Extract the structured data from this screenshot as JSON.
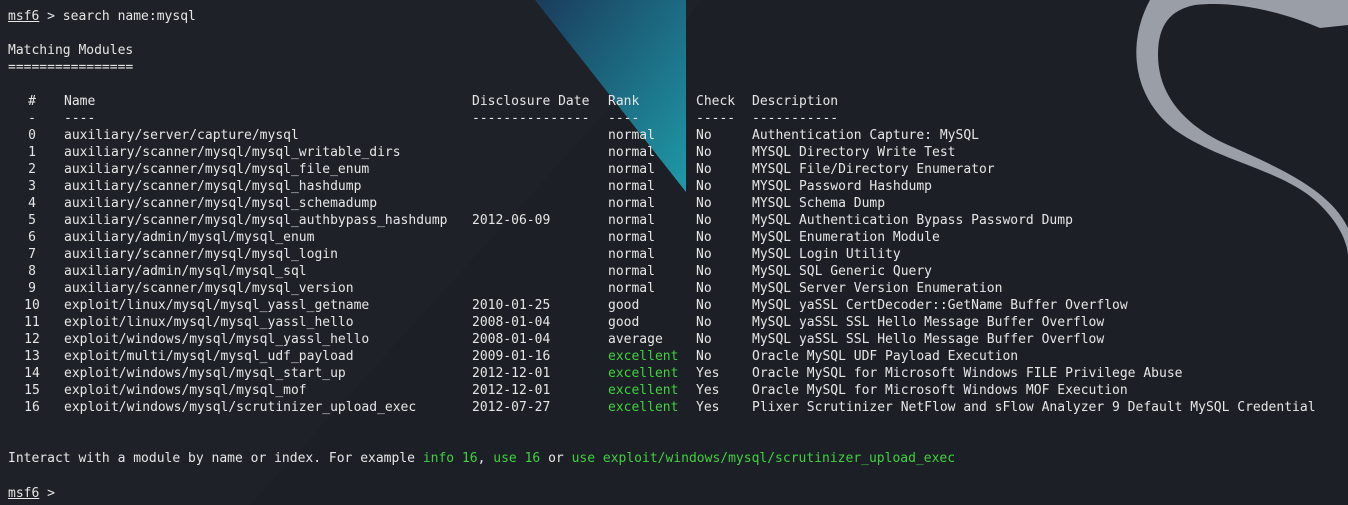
{
  "colors": {
    "background": "#1c1f26",
    "text": "#e6e6e6",
    "highlight": "#3fd13f",
    "accent_teal": "#1e8fa3"
  },
  "prompt": {
    "name": "msf6",
    "arrow": " >",
    "command": " search name:mysql"
  },
  "heading": {
    "title": "Matching Modules",
    "underline": "================"
  },
  "table": {
    "headers": {
      "num": "#",
      "name": "Name",
      "date": "Disclosure Date",
      "rank": "Rank",
      "check": "Check",
      "desc": "Description"
    },
    "dashes": {
      "num": "-",
      "name": "----",
      "date": "---------------",
      "rank": "----",
      "check": "-----",
      "desc": "-----------"
    },
    "rows": [
      {
        "num": "0",
        "name": "auxiliary/server/capture/mysql",
        "date": "",
        "rank": "normal",
        "check": "No",
        "desc": "Authentication Capture: MySQL"
      },
      {
        "num": "1",
        "name": "auxiliary/scanner/mysql/mysql_writable_dirs",
        "date": "",
        "rank": "normal",
        "check": "No",
        "desc": "MYSQL Directory Write Test"
      },
      {
        "num": "2",
        "name": "auxiliary/scanner/mysql/mysql_file_enum",
        "date": "",
        "rank": "normal",
        "check": "No",
        "desc": "MYSQL File/Directory Enumerator"
      },
      {
        "num": "3",
        "name": "auxiliary/scanner/mysql/mysql_hashdump",
        "date": "",
        "rank": "normal",
        "check": "No",
        "desc": "MYSQL Password Hashdump"
      },
      {
        "num": "4",
        "name": "auxiliary/scanner/mysql/mysql_schemadump",
        "date": "",
        "rank": "normal",
        "check": "No",
        "desc": "MYSQL Schema Dump"
      },
      {
        "num": "5",
        "name": "auxiliary/scanner/mysql/mysql_authbypass_hashdump",
        "date": "2012-06-09",
        "rank": "normal",
        "check": "No",
        "desc": "MySQL Authentication Bypass Password Dump"
      },
      {
        "num": "6",
        "name": "auxiliary/admin/mysql/mysql_enum",
        "date": "",
        "rank": "normal",
        "check": "No",
        "desc": "MySQL Enumeration Module"
      },
      {
        "num": "7",
        "name": "auxiliary/scanner/mysql/mysql_login",
        "date": "",
        "rank": "normal",
        "check": "No",
        "desc": "MySQL Login Utility"
      },
      {
        "num": "8",
        "name": "auxiliary/admin/mysql/mysql_sql",
        "date": "",
        "rank": "normal",
        "check": "No",
        "desc": "MySQL SQL Generic Query"
      },
      {
        "num": "9",
        "name": "auxiliary/scanner/mysql/mysql_version",
        "date": "",
        "rank": "normal",
        "check": "No",
        "desc": "MySQL Server Version Enumeration"
      },
      {
        "num": "10",
        "name": "exploit/linux/mysql/mysql_yassl_getname",
        "date": "2010-01-25",
        "rank": "good",
        "check": "No",
        "desc": "MySQL yaSSL CertDecoder::GetName Buffer Overflow"
      },
      {
        "num": "11",
        "name": "exploit/linux/mysql/mysql_yassl_hello",
        "date": "2008-01-04",
        "rank": "good",
        "check": "No",
        "desc": "MySQL yaSSL SSL Hello Message Buffer Overflow"
      },
      {
        "num": "12",
        "name": "exploit/windows/mysql/mysql_yassl_hello",
        "date": "2008-01-04",
        "rank": "average",
        "check": "No",
        "desc": "MySQL yaSSL SSL Hello Message Buffer Overflow"
      },
      {
        "num": "13",
        "name": "exploit/multi/mysql/mysql_udf_payload",
        "date": "2009-01-16",
        "rank": "excellent",
        "check": "No",
        "desc": "Oracle MySQL UDF Payload Execution"
      },
      {
        "num": "14",
        "name": "exploit/windows/mysql/mysql_start_up",
        "date": "2012-12-01",
        "rank": "excellent",
        "check": "Yes",
        "desc": "Oracle MySQL for Microsoft Windows FILE Privilege Abuse"
      },
      {
        "num": "15",
        "name": "exploit/windows/mysql/mysql_mof",
        "date": "2012-12-01",
        "rank": "excellent",
        "check": "Yes",
        "desc": "Oracle MySQL for Microsoft Windows MOF Execution"
      },
      {
        "num": "16",
        "name": "exploit/windows/mysql/scrutinizer_upload_exec",
        "date": "2012-07-27",
        "rank": "excellent",
        "check": "Yes",
        "desc": "Plixer Scrutinizer NetFlow and sFlow Analyzer 9 Default MySQL Credential"
      }
    ]
  },
  "footer": {
    "text1": "Interact with a module by name or index. For example ",
    "cmd1": "info 16",
    "sep1": ", ",
    "cmd2": "use 16",
    "sep2": " or ",
    "cmd3": "use exploit/windows/mysql/scrutinizer_upload_exec"
  },
  "prompt2": {
    "name": "msf6",
    "arrow": " >"
  }
}
